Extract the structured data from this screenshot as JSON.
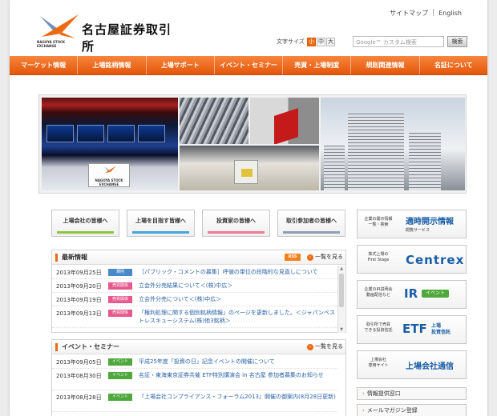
{
  "header": {
    "logo_title": "名古屋証券取引所",
    "logo_sub": "NAGOYA STOCK EXCHANGE",
    "sitemap": "サイトマップ",
    "english": "English",
    "font_size_label": "文字サイズ",
    "font_sizes": [
      "小",
      "中",
      "大"
    ],
    "search_placeholder": "Google™ カスタム検索",
    "search_button": "検索"
  },
  "nav": [
    "マーケット情報",
    "上場銘柄情報",
    "上場サポート",
    "イベント・セミナー",
    "売買・上場制度",
    "規則関連情報",
    "名証について"
  ],
  "hero": {
    "board_text": "NAGOYA STOCK EXCHANGE"
  },
  "targets": [
    "上場会社の皆様へ",
    "上場を目指す皆様へ",
    "投資家の皆様へ",
    "取引参加者の皆様へ"
  ],
  "news": {
    "title": "最新情報",
    "rss": "RSS",
    "more": "一覧を見る",
    "items": [
      {
        "date": "2013年09月25日",
        "badge": "規則",
        "text": "［パブリック・コメントの募集］呼値の単位の段階的な見直しについて"
      },
      {
        "date": "2013年09月20日",
        "badge": "売買関係",
        "text": "立会外分売結果について＜(株)中広＞"
      },
      {
        "date": "2013年09月19日",
        "badge": "売買関係",
        "text": "立会外分売について＜(株)中広＞"
      },
      {
        "date": "2013年09月13日",
        "badge": "売買関係",
        "text": "「権利処理に関する個別銘柄情報」のページを更新しました。＜ジャパンベストレスキューシステム(株)他3銘柄＞"
      }
    ]
  },
  "events": {
    "title": "イベント・セミナー",
    "more": "一覧を見る",
    "items": [
      {
        "date": "2013年09月05日",
        "badge": "イベント",
        "text": "平成25年度「投資の日」記念イベントの開催について"
      },
      {
        "date": "2013年08月30日",
        "badge": "イベント",
        "text": "名証・東海東京証券共催 ETF特別講演会 in 名古屋 参加者募集のお知らせ"
      },
      {
        "date": "2013年08月28日",
        "badge": "イベント",
        "text": "『上場会社コンプライアンス・フォーラム2013』開催の御案内(8月28日更新)"
      }
    ]
  },
  "side": {
    "timely_small": "企業の開示情報\n一覧・検索",
    "timely_big": "適時開示情報",
    "timely_note": "閲覧サービス",
    "centrex_small": "株式上場の\nFirst Stage",
    "centrex_big": "Centrex",
    "ir_small": "企業のIR説明会\n動画配信など",
    "ir_big": "IR",
    "ir_badge": "イベント",
    "etf_small": "取引所で売買\nできる投資信託",
    "etf_big": "ETF",
    "etf_note": "上場\n投資信託",
    "tsushin_small": "上場会社\n専用サイト",
    "tsushin_big": "上場会社通信",
    "link1": "情報提供窓口",
    "link2": "メールマガジン登録"
  }
}
